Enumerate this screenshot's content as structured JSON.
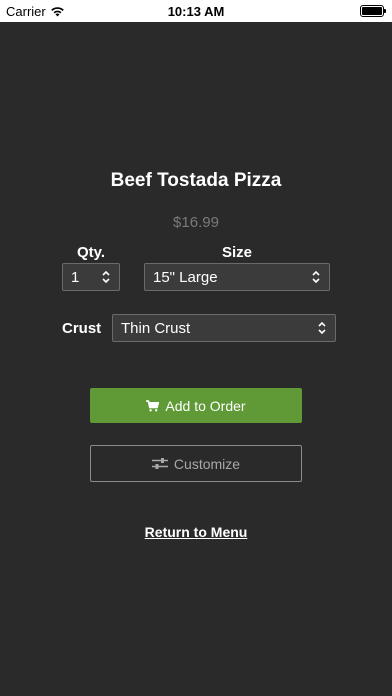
{
  "status_bar": {
    "carrier": "Carrier",
    "time": "10:13 AM",
    "icons": [
      "wifi-icon",
      "battery-icon"
    ]
  },
  "product": {
    "title": "Beef Tostada Pizza",
    "price": "$16.99"
  },
  "options": {
    "qty_label": "Qty.",
    "qty_value": "1",
    "size_label": "Size",
    "size_value": "15\" Large",
    "crust_label": "Crust",
    "crust_value": "Thin Crust"
  },
  "actions": {
    "add_label": "Add to Order",
    "add_icon": "cart-icon",
    "customize_label": "Customize",
    "customize_icon": "sliders-icon",
    "return_label": "Return to Menu"
  },
  "colors": {
    "background": "#2a2a2a",
    "accent_green": "#5f9a36",
    "price_gray": "#7a7a7a",
    "field_bg": "#3b3b3b"
  }
}
